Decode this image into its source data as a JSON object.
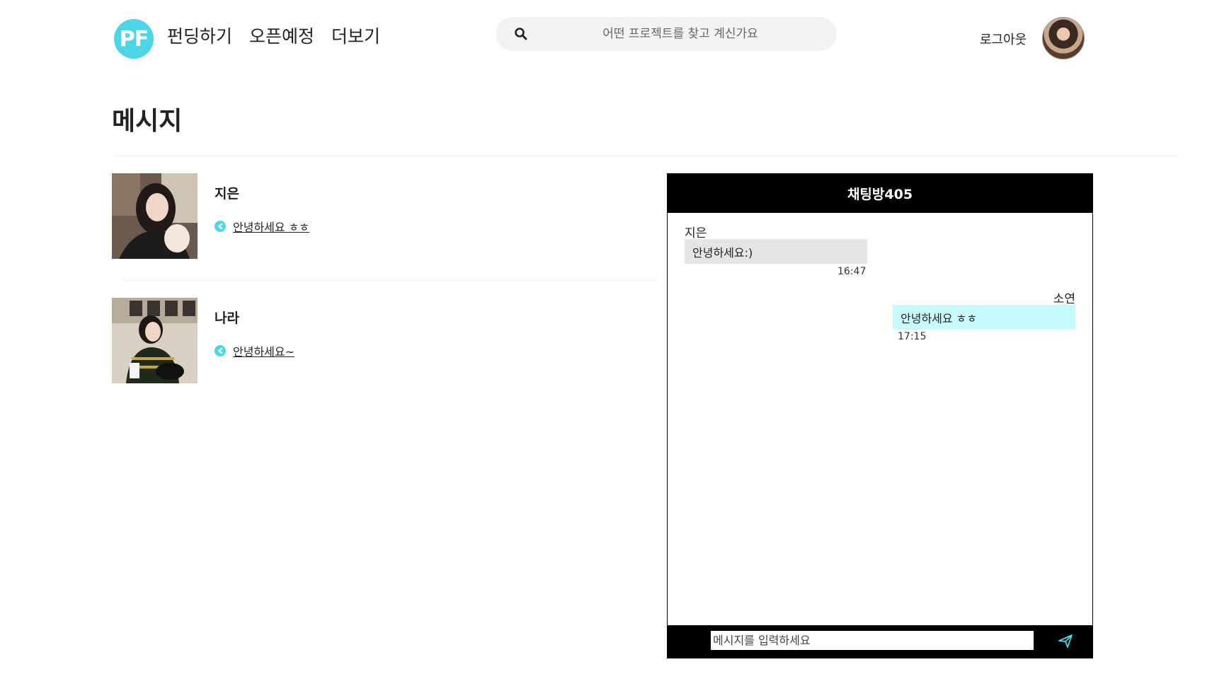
{
  "header": {
    "logo_text": "PF",
    "nav": [
      "펀딩하기",
      "오픈예정",
      "더보기"
    ],
    "search_placeholder": "어떤 프로젝트를 찾고 계신가요",
    "logout_label": "로그아웃"
  },
  "page_title": "메시지",
  "conversations": [
    {
      "name": "지은",
      "last_message": "안녕하세요 ㅎㅎ"
    },
    {
      "name": "나라",
      "last_message": "안녕하세요~"
    }
  ],
  "chat": {
    "room_title": "채팅방405",
    "messages": [
      {
        "sender": "지은",
        "text": "안녕하세요:)",
        "time": "16:47",
        "direction": "incoming"
      },
      {
        "sender": "소연",
        "text": "안녕하세요 ㅎㅎ",
        "time": "17:15",
        "direction": "outgoing"
      }
    ],
    "input_placeholder": "메시지를 입력하세요"
  },
  "colors": {
    "accent": "#4dd6e8",
    "incoming_bubble": "#e5e5e5",
    "outgoing_bubble": "#c8fbfc",
    "chat_bar": "#000000"
  }
}
